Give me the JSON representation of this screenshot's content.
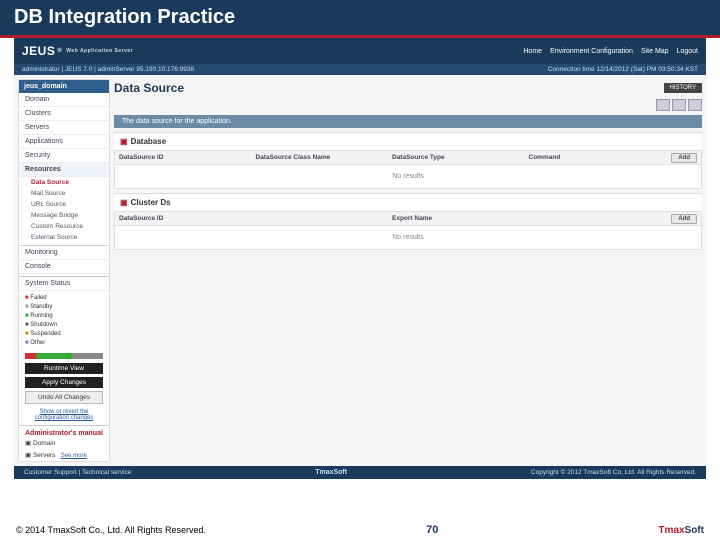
{
  "slide": {
    "title": "DB Integration Practice",
    "copyright": "© 2014 TmaxSoft Co., Ltd. All Rights Reserved.",
    "page": "70",
    "brand_a": "Tmax",
    "brand_b": "Soft"
  },
  "topbar": {
    "logo": "JEUS",
    "logo_sub": "Web Application Server",
    "nav": {
      "home": "Home",
      "env": "Environment Configuration",
      "sitemap": "Site Map",
      "logout": "Logout"
    }
  },
  "subbar": {
    "left": "administrator | JEUS 7.0 | adminServer 95.190.10.176:9936",
    "right": "Connection time 12/14/2012 (Sat) PM 03:50:34 KST"
  },
  "sidebar": {
    "domain": "jeus_domain",
    "items": {
      "domain": "Domain",
      "clusters": "Clusters",
      "servers": "Servers",
      "applications": "Applications",
      "security": "Security",
      "resources": "Resources"
    },
    "subres": {
      "datasource": "Data Source",
      "mail": "Mail Source",
      "url": "URL Source",
      "msgbridge": "Message Bridge",
      "custom": "Custom Resource",
      "external": "External Source"
    },
    "monitoring": "Monitoring",
    "console": "Console",
    "system_status": "System Status",
    "statuses": {
      "failed": "Failed",
      "standby": "Standby",
      "running": "Running",
      "shutdown": "Shutdown",
      "suspended": "Suspended",
      "other": "Other"
    },
    "btn_runtime": "Runtime View",
    "btn_apply": "Apply Changes",
    "btn_undo": "Undo All Changes",
    "link_pending": "Show or revert the configuration changes",
    "manual_head": "Administrator's manual",
    "manual_domain": "Domain",
    "manual_servers": "Servers",
    "manual_more": "See more"
  },
  "main": {
    "title": "Data Source",
    "history": "HISTORY",
    "description": "The data source for the application.",
    "database": {
      "heading": "Database",
      "cols": {
        "id": "DataSource ID",
        "class": "DataSource Class Name",
        "type": "DataSource Type",
        "command": "Command"
      },
      "add": "Add",
      "noresult": "No results"
    },
    "cluster": {
      "heading": "Cluster Ds",
      "cols": {
        "id": "DataSource ID",
        "export": "Export Name"
      },
      "add": "Add",
      "noresult": "No results"
    }
  },
  "footer": {
    "left": "Customer Support  |  Technical service",
    "center": "TmaxSoft",
    "right": "Copyright © 2012 TmaxSoft Co, Ltd. All Rights Reserved."
  }
}
